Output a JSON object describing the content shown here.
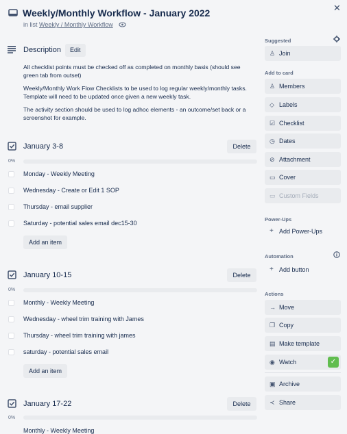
{
  "card": {
    "title": "Weekly/Monthly Workflow - January 2022",
    "list_prefix": "in list",
    "list_name": "Weekly / Monthly Workflow"
  },
  "description": {
    "heading": "Description",
    "edit_label": "Edit",
    "paragraphs": [
      "All checklist points must be checked off as completed on monthly basis (should see green tab from outset)",
      "Weekly/Monthly Work Flow Checklists to be used to log regular weekly/monthly tasks. Template will need to be updated once given a new weekly task.",
      "The activity section should be used to log adhoc elements - an outcome/set back or a screenshot for example."
    ]
  },
  "checklists": [
    {
      "title": "January 3-8",
      "progress": "0%",
      "delete_label": "Delete",
      "items": [
        "Monday - Weekly Meeting",
        "Wednesday - Create or Edit 1 SOP",
        "Thursday - email supplier",
        "Saturday - potential sales email dec15-30"
      ],
      "add_label": "Add an item"
    },
    {
      "title": "January 10-15",
      "progress": "0%",
      "delete_label": "Delete",
      "items": [
        "Monthly - Weekly Meeting",
        "Wednesday - wheel trim training with James",
        "Thursday - wheel trim training with james",
        "saturday - potential sales email"
      ],
      "add_label": "Add an item"
    },
    {
      "title": "January 17-22",
      "progress": "0%",
      "delete_label": "Delete",
      "items": [
        "Monthly - Weekly Meeting"
      ]
    }
  ],
  "sidebar": {
    "suggested_label": "Suggested",
    "join": "Join",
    "add_to_card_label": "Add to card",
    "members": "Members",
    "labels": "Labels",
    "checklist": "Checklist",
    "dates": "Dates",
    "attachment": "Attachment",
    "cover": "Cover",
    "custom_fields": "Custom Fields",
    "powerups_label": "Power-Ups",
    "add_powerups": "Add Power-Ups",
    "automation_label": "Automation",
    "add_button": "Add button",
    "actions_label": "Actions",
    "move": "Move",
    "copy": "Copy",
    "make_template": "Make template",
    "watch": "Watch",
    "archive": "Archive",
    "share": "Share"
  },
  "colors": {
    "watch_check": "#61bd4f"
  }
}
